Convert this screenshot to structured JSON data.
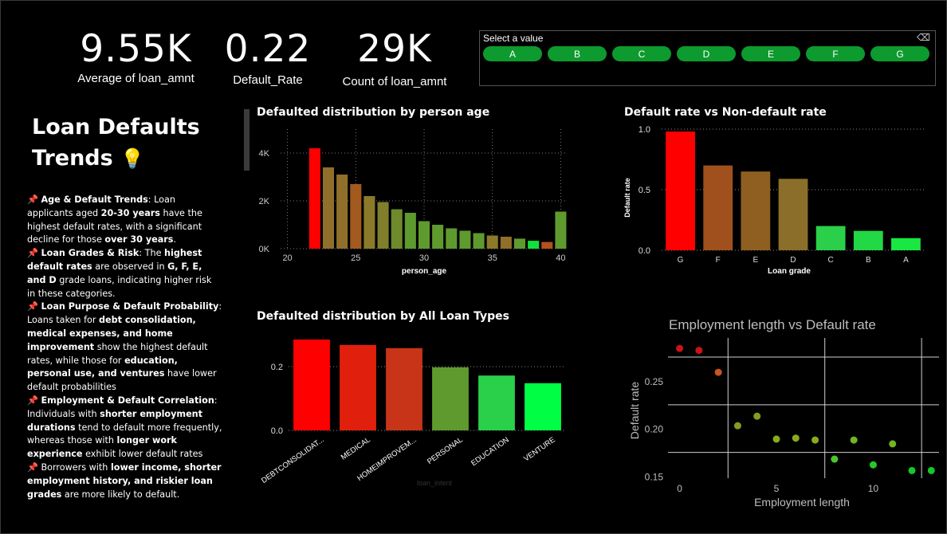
{
  "kpis": [
    {
      "value": "9.55K",
      "label": "Average of loan_amnt"
    },
    {
      "value": "0.22",
      "label": "Default_Rate"
    },
    {
      "value": "29K",
      "label": "Count of loan_amnt"
    }
  ],
  "slicer": {
    "header": "Select a value",
    "erase_icon": "eraser-icon",
    "options": [
      "A",
      "B",
      "C",
      "D",
      "E",
      "F",
      "G"
    ],
    "button_color": "#0d9a2e"
  },
  "headline": {
    "line1": "Loan Defaults",
    "line2": "Trends",
    "icon": "💡"
  },
  "notes": {
    "pin": "📌",
    "age": {
      "t1": "Age & Default Trends",
      "t2": ": Loan applicants aged ",
      "t3": "20-30 years",
      "t4": " have the highest default rates, with a significant decline for those ",
      "t5": "over 30 years",
      "t6": "."
    },
    "grades": {
      "t1": "Loan Grades & Risk",
      "t2": ": The ",
      "t3": "highest default rates",
      "t4": " are observed in ",
      "t5": "G, F, E, and D",
      "t6": " grade loans, indicating higher risk in these categories."
    },
    "purpose": {
      "t1": "Loan Purpose & Default Probability",
      "t2": ": Loans taken for ",
      "t3": "debt consolidation, medical expenses, and home improvement",
      "t4": " show the highest default rates, while those for ",
      "t5": "education, personal use, and ventures",
      "t6": " have lower default probabilities"
    },
    "employment": {
      "t1": "Employment & Default Correlation",
      "t2": ": Individuals with ",
      "t3": "shorter employment durations",
      "t4": " tend to default more frequently, whereas those with ",
      "t5": "longer work experience",
      "t6": " exhibit lower default rates"
    },
    "borrowers": {
      "t1": "Borrowers with ",
      "t2": "lower income, shorter employment history, and riskier loan grades",
      "t3": " are more likely to default."
    }
  },
  "chart_data": [
    {
      "type": "bar",
      "title": "Defaulted distribution by person age",
      "xlabel": "person_age",
      "ylabel": "",
      "x": [
        22,
        23,
        24,
        25,
        26,
        27,
        28,
        29,
        30,
        31,
        32,
        33,
        34,
        35,
        36,
        37,
        38,
        39,
        40
      ],
      "values": [
        4200,
        3400,
        3100,
        2700,
        2200,
        1950,
        1650,
        1500,
        1150,
        1000,
        850,
        750,
        650,
        550,
        500,
        420,
        330,
        280,
        1550
      ],
      "colors": [
        "#ff0000",
        "#8f6f2a",
        "#8f6f2a",
        "#a35a1f",
        "#8a7a2a",
        "#7f7f2c",
        "#6e8a2d",
        "#5f9a2e",
        "#5f9a2e",
        "#5f9a2e",
        "#5f9a2e",
        "#5f9a2e",
        "#5f9a2e",
        "#8a7a2a",
        "#8f6f2a",
        "#5f9a2e",
        "#14e03c",
        "#b5501c",
        "#5f9a2e"
      ],
      "xlim": [
        19.5,
        40.5
      ],
      "ylim": [
        0,
        5000
      ],
      "xticks": [
        {
          "v": 20,
          "label": "20"
        },
        {
          "v": 25,
          "label": "25"
        },
        {
          "v": 30,
          "label": "30"
        },
        {
          "v": 35,
          "label": "35"
        },
        {
          "v": 40,
          "label": "40"
        }
      ],
      "yticks": [
        {
          "v": 0,
          "label": "0K"
        },
        {
          "v": 2000,
          "label": "2K"
        },
        {
          "v": 4000,
          "label": "4K"
        }
      ],
      "grid": true
    },
    {
      "type": "bar",
      "title": "Default rate vs Non-default rate",
      "xlabel": "Loan grade",
      "ylabel": "Default rate",
      "categories": [
        "G",
        "F",
        "E",
        "D",
        "C",
        "B",
        "A"
      ],
      "values": [
        0.98,
        0.7,
        0.65,
        0.59,
        0.2,
        0.16,
        0.1
      ],
      "colors": [
        "#ff0000",
        "#a0501d",
        "#8f5f22",
        "#8a6e2a",
        "#2ad04a",
        "#22d845",
        "#19e842"
      ],
      "ylim": [
        0,
        1.0
      ],
      "yticks": [
        {
          "v": 0,
          "label": "0.0"
        },
        {
          "v": 0.5,
          "label": "0.5"
        },
        {
          "v": 1.0,
          "label": "1.0"
        }
      ],
      "grid": true
    },
    {
      "type": "bar",
      "title": "Defaulted distribution by All Loan Types",
      "xlabel": "loan_intent",
      "ylabel": "",
      "categories": [
        "DEBTCONSOLIDAT...",
        "MEDICAL",
        "HOMEIMPROVEM...",
        "PERSONAL",
        "EDUCATION",
        "VENTURE"
      ],
      "values": [
        0.285,
        0.268,
        0.258,
        0.198,
        0.172,
        0.148
      ],
      "colors": [
        "#ff0000",
        "#e0200c",
        "#c83418",
        "#5f9a2e",
        "#2ad04a",
        "#00ff44"
      ],
      "ylim": [
        0,
        0.3
      ],
      "yticks": [
        {
          "v": 0,
          "label": "0.0"
        },
        {
          "v": 0.2,
          "label": "0.2"
        }
      ],
      "grid": true
    },
    {
      "type": "scatter",
      "title": "Employment length vs Default rate",
      "xlabel": "Employment length",
      "ylabel": "Default rate",
      "x": [
        0,
        1,
        2,
        3,
        4,
        5,
        6,
        7,
        8,
        9,
        10,
        11,
        12,
        13
      ],
      "y": [
        0.284,
        0.282,
        0.259,
        0.203,
        0.213,
        0.189,
        0.19,
        0.188,
        0.168,
        0.188,
        0.162,
        0.184,
        0.156,
        0.156
      ],
      "colors": [
        "#c81414",
        "#c81414",
        "#c8551e",
        "#8a9a1e",
        "#8a9a1e",
        "#8aaa1e",
        "#8aaa1e",
        "#8aaa1e",
        "#46c828",
        "#72b423",
        "#28c828",
        "#72b423",
        "#14c828",
        "#14c828"
      ],
      "xlim": [
        -0.6,
        13.4
      ],
      "ylim": [
        0.148,
        0.29
      ],
      "xticks": [
        {
          "v": 0,
          "label": "0"
        },
        {
          "v": 5,
          "label": "5"
        },
        {
          "v": 10,
          "label": "10"
        }
      ],
      "yticks": [
        {
          "v": 0.15,
          "label": "0.15"
        },
        {
          "v": 0.2,
          "label": "0.20"
        },
        {
          "v": 0.25,
          "label": "0.25"
        }
      ],
      "grid": true
    }
  ]
}
